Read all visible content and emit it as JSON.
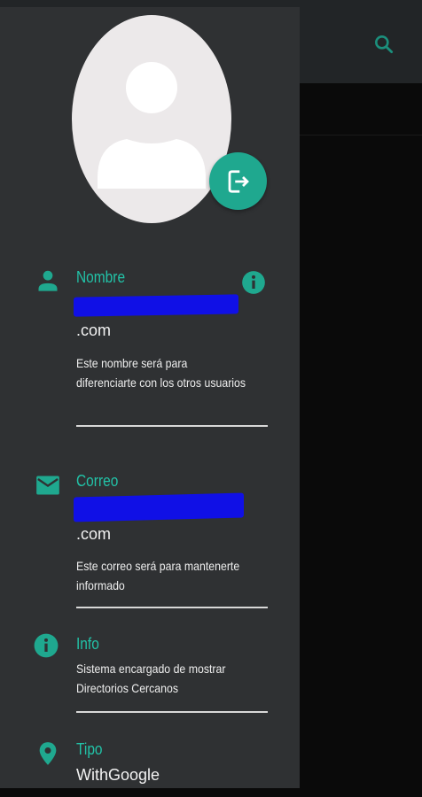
{
  "colors": {
    "accent": "#1fa88f",
    "label": "#22c3a8",
    "drawer_bg": "#2f3133",
    "redaction": "#1010e6"
  },
  "header": {
    "search_icon": "search-icon"
  },
  "profile": {
    "avatar_icon": "person-icon",
    "logout_icon": "logout-icon"
  },
  "sections": {
    "nombre": {
      "icon": "person-icon",
      "label": "Nombre",
      "value_suffix": ".com",
      "description": "Este nombre será para diferenciarte con los otros usuarios",
      "info_icon": "info-icon"
    },
    "correo": {
      "icon": "mail-icon",
      "label": "Correo",
      "value_suffix": ".com",
      "description": "Este correo será para mantenerte informado"
    },
    "info": {
      "icon": "info-icon",
      "label": "Info",
      "description": "Sistema encargado de mostrar Directorios Cercanos"
    },
    "tipo": {
      "icon": "location-pin-icon",
      "label": "Tipo",
      "value": "WithGoogle"
    }
  }
}
